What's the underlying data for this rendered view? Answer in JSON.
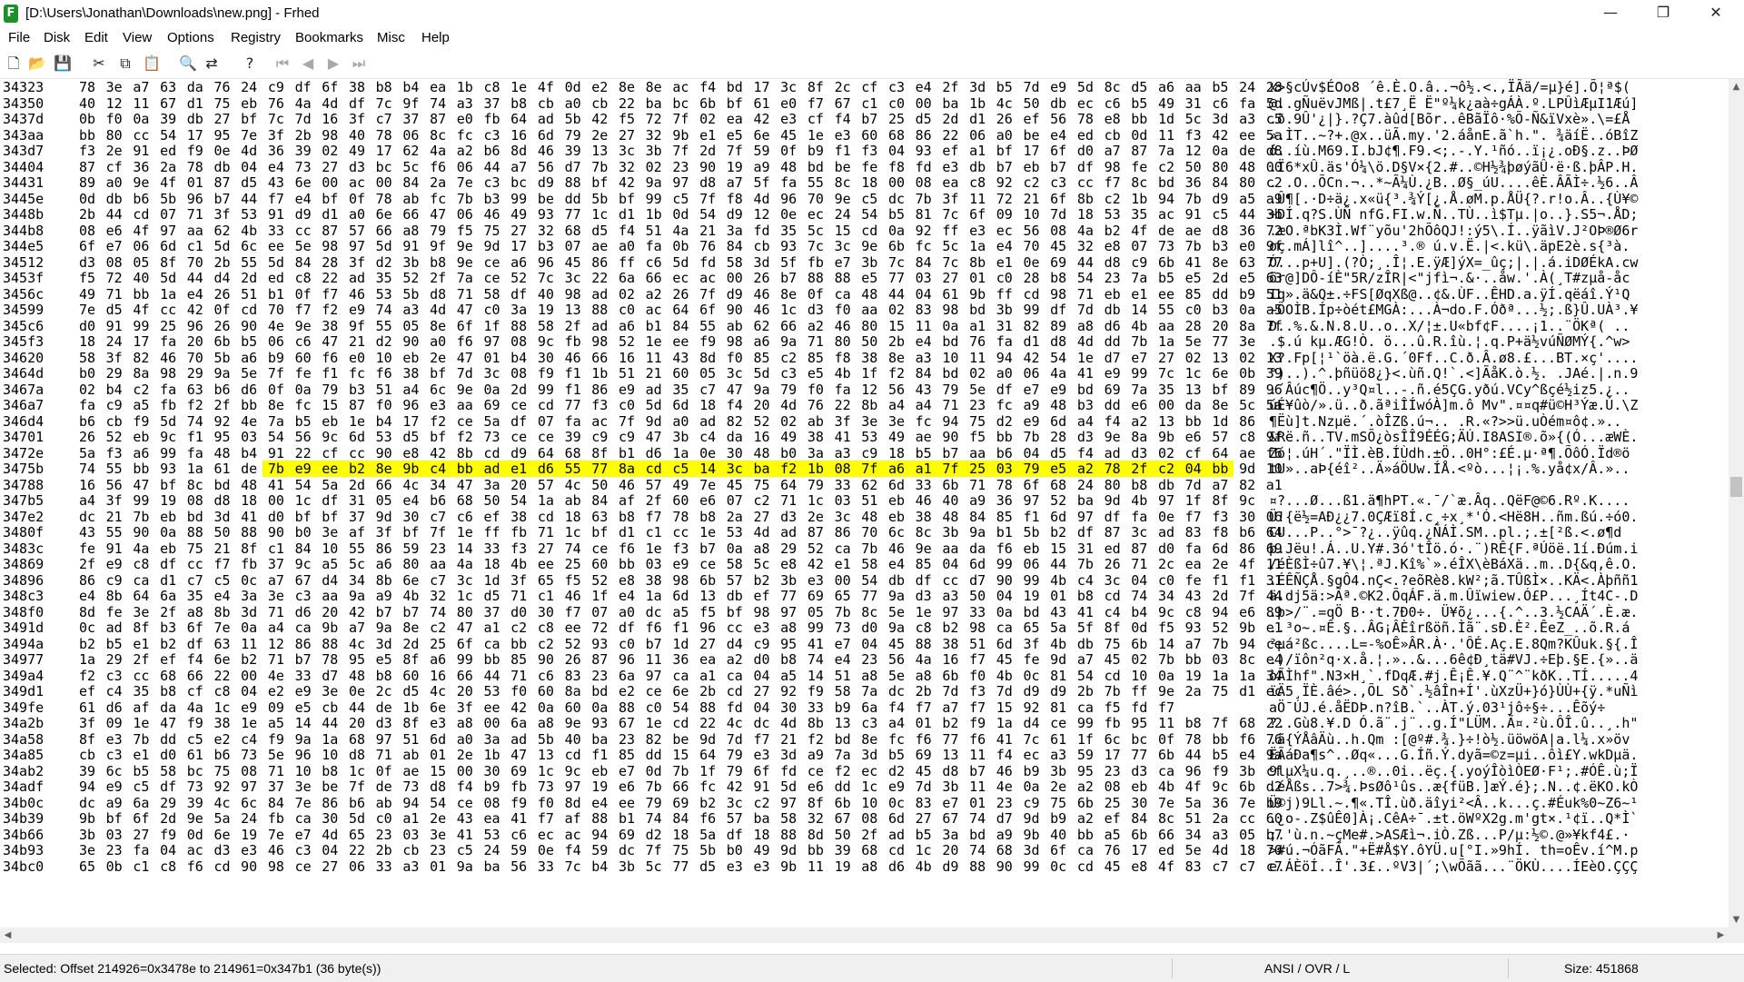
{
  "window": {
    "title": "[D:\\Users\\Jonathan\\Downloads\\new.png] - Frhed",
    "app_icon_letter": "F",
    "minimize": "—",
    "maximize": "❐",
    "close": "✕"
  },
  "menu": [
    "File",
    "Disk",
    "Edit",
    "View",
    "Options",
    "Registry",
    "Bookmarks",
    "Misc",
    "Help"
  ],
  "toolbar": {
    "buttons": [
      {
        "name": "new-file-icon",
        "glyph": "🗋",
        "disabled": false
      },
      {
        "name": "open-folder-icon",
        "glyph": "📂",
        "disabled": false
      },
      {
        "name": "save-icon",
        "glyph": "💾",
        "disabled": false
      },
      {
        "name": "cut-icon",
        "glyph": "✂",
        "disabled": false
      },
      {
        "name": "copy-icon",
        "glyph": "⧉",
        "disabled": false
      },
      {
        "name": "paste-icon",
        "glyph": "📋",
        "disabled": false
      },
      {
        "name": "find-icon",
        "glyph": "🔍",
        "disabled": false
      },
      {
        "name": "replace-icon",
        "glyph": "⇄",
        "disabled": false
      },
      {
        "name": "help-icon",
        "glyph": "?",
        "disabled": false
      },
      {
        "name": "first-icon",
        "glyph": "⏮",
        "disabled": true
      },
      {
        "name": "prev-icon",
        "glyph": "◀",
        "disabled": true
      },
      {
        "name": "next-icon",
        "glyph": "▶",
        "disabled": true
      },
      {
        "name": "last-icon",
        "glyph": "⏭",
        "disabled": true
      }
    ]
  },
  "hex_view": {
    "selected_row": 24,
    "selected_start_col": 7,
    "selected_end_col": 42,
    "rows": [
      {
        "offset": "34323",
        "bytes": "78 3e a7 63 da 76 24 c9 df 6f 38 b8 b4 ea 1b c8 1e 4f 0d e2 8e 8e ac f4 bd 17 3c 8f 2c cf c3 e4 2f 3d b5 7d e9 5d 8c d5 a6 aa b5 24 28",
        "ascii": "x>§cÚv$É߀o8 ´ê.È.O.â..¬ô½.<.,ÏÃä/=µ}é].Õ¦ª$("
      },
      {
        "offset": "34350",
        "bytes": "40 12 11 67 d1 75 eb 76 4a 4d df 7c 9f 74 a3 37 b8 cb a0 cb 22 ba bc 6b bf 61 e0 f7 67 c1 c0 00 ba 1b 4c 50 db ec c6 b5 49 31 c6 fa 5d",
        "ascii": "@..gÑuëvJMß|.t£7¸Ë Ë\"º¼k¿aà÷gÁÀ.º.LPÛìÆµI1Æú]"
      },
      {
        "offset": "3437d",
        "bytes": "0b f0 0a 39 db 27 bf 7c 7d 16 3f c7 37 87 e0 fb 64 ad 5b 42 f5 72 7f 02 ea 42 e3 cf f4 b7 25 d5 2d d1 26 ef 56 78 e8 bb 1d 5c 3d a3 c5",
        "ascii": ".ð.9Û'¿|}.?Ç7.àûd­[Bõr..êBãÏô·%Õ-Ñ&ïVxè».\\=£Å"
      },
      {
        "offset": "343aa",
        "bytes": "bb 80 cc 54 17 95 7e 3f 2b 98 40 78 06 8c fc c3 16 6d 79 2e 27 32 9b e1 e5 6e 45 1e e3 60 68 86 22 06 a0 be e4 ed cb 0d 11 f3 42 ee 5a",
        "ascii": "».ÌT..~?+.@x..üÃ.my.'2.áånE.ã`h.\". ¾äíË..óBîZ"
      },
      {
        "offset": "343d7",
        "bytes": "f3 2e 91 ed f9 0e 4d 36 39 02 49 17 62 4a a2 b6 8d 46 39 13 3c 3b 7f 2d 7f 59 0f b9 f1 f3 04 93 ef a1 bf 17 6f d0 a7 87 7a 12 0a de d8",
        "ascii": "ó..íù.M69.I.bJ¢¶.F9.<;.-.Y.¹ñó..ï¡¿.oÐ§.z..ÞØ"
      },
      {
        "offset": "34404",
        "bytes": "87 cf 36 2a 78 db 04 e4 73 27 d3 bc 5c f6 06 44 a7 56 d7 7b 32 02 23 90 19 a9 48 bd be fe f8 fd e3 db b7 eb b7 df 98 fe c2 50 80 48 00",
        "ascii": ".Ï6*xÛ.äs'Ó¼\\ö.D§V×{2.#..©H½¾þøýãÛ·ë·ß.þÂP.H."
      },
      {
        "offset": "34431",
        "bytes": "89 a0 9e 4f 01 87 d5 43 6e 00 ac 00 84 2a 7e c3 bc d9 88 bf 42 9a 97 d8 a7 5f fa 55 8c 18 00 08 ea c8 92 c2 c3 cc f7 8c bd 36 84 80 c2",
        "ascii": ". .O..ÕCn.¬..*~Ã¼Ù.¿B..Ø§_úU....êÈ.ÂÃÌ÷.½6..Â"
      },
      {
        "offset": "3445e",
        "bytes": "0d db b6 5b 96 b7 44 f7 e4 bf 0f 78 ab fc 7b b3 99 be dd 5b bf 99 c5 7f f8 4d 96 70 9e c5 dc 7b 3f 11 72 21 6f 8b c2 1b 94 7b d9 a5 a9",
        "ascii": ".Û¶[.·D÷ä¿.x«ü{³.¾Ý[¿.Å.øM.p.ÅÜ{?.r!o.Â..{Ù¥©"
      },
      {
        "offset": "3448b",
        "bytes": "2b 44 cd 07 71 3f 53 91 d9 d1 a0 6e 66 47 06 46 49 93 77 1c d1 1b 0d 54 d9 12 0e ec 24 54 b5 81 7c 6f 09 10 7d 18 53 35 ac 91 c5 44 3b",
        "ascii": "+DÍ.q?S.ÙÑ nfG.FI.w.Ñ..TÙ..ì$Tµ.|o..}.S5¬.ÅD;"
      },
      {
        "offset": "344b8",
        "bytes": "08 e6 4f 97 aa 62 4b 33 cc 87 57 66 a8 79 f5 75 27 32 68 d5 f4 51 4a 21 3a fd 35 5c 15 cd 0a 92 ff e3 ec 56 08 4a b2 4f de ae d8 36 72",
        "ascii": ".æO.ªbK3Ì.Wf¨yõu'2hÕôQJ!:ý5\\.Í..ÿãìV.J²OÞ®Ø6r"
      },
      {
        "offset": "344e5",
        "bytes": "6f e7 06 6d c1 5d 6c ee 5e 98 97 5d 91 9f 9e 9d 17 b3 07 ae a0 fa 0b 76 84 cb 93 7c 3c 9e 6b fc 5c 1a e4 70 45 32 e8 07 73 7b b3 e0 9f",
        "ascii": "oç.mÁ]lî^..]....³.® ú.v.Ë.|<.kü\\.äpE2è.s{³à."
      },
      {
        "offset": "34512",
        "bytes": "d3 08 05 8f 70 2b 55 5d 84 28 3f d2 3b b8 9e ce a6 96 45 86 ff c6 5d fd 58 3d 5f fb e7 3b 7c 84 7c 8b e1 0e 69 44 d8 c9 6b 41 8e 63 77",
        "ascii": "Ó...p+U].(?Ò;¸.Î¦.E.ÿÆ]ýX=_ûç;|.|.á.iDØÉkA.cw"
      },
      {
        "offset": "3453f",
        "bytes": "f5 72 40 5d 44 d4 2d ed c8 22 ad 35 52 2f 7a ce 52 7c 3c 22 6a 66 ec ac 00 26 b7 88 88 e5 77 03 27 01 c0 28 b8 54 23 7a b5 e5 2d e5 63",
        "ascii": "õr@]DÔ-íÈ\"­5R/zÎR|<\"jfì¬.&·..åw.'.À(¸T#zµå-åc"
      },
      {
        "offset": "3456c",
        "bytes": "49 71 bb 1a e4 26 51 b1 0f f7 46 53 5b d8 71 58 df 40 98 ad 02 a2 26 7f d9 46 8e 0f ca 48 44 04 61 9b ff cd 98 71 eb e1 ee 85 dd b9 51",
        "ascii": "Iq».ä&Q±.÷FS[ØqXß@.­.¢&.ÙF..ÊHD.a.ÿÍ.qëáî.Ý¹Q"
      },
      {
        "offset": "34599",
        "bytes": "7e d5 4f cc 42 0f cd 70 f7 f2 e9 74 a3 4d 47 c0 3a 19 13 88 c0 ac 64 6f 90 46 1c d3 f0 aa 02 83 98 bd 3b 99 df 7d db 14 55 c0 b3 0a a5",
        "ascii": "~ÕOÌB.Íp÷òét£MGÀ:...À¬do.F.Óðª...½;.ß}Û.UÀ³.¥"
      },
      {
        "offset": "345c6",
        "bytes": "d0 91 99 25 96 26 90 4e 9e 38 9f 55 05 8e 6f 1f 88 58 2f ad a6 b1 84 55 ab 62 66 a2 46 80 15 11 0a a1 31 82 89 a8 d6 4b aa 28 20 8a 7f",
        "ascii": "Ð..%.&.N.8.U..o..X/­¦±.U«bf¢F....¡1..¨ÖKª( .."
      },
      {
        "offset": "345f3",
        "bytes": "18 24 17 fa 20 6b b5 06 c6 47 21 d2 90 a0 f6 97 08 9c fb 98 52 1e ee f9 98 a6 9a 71 80 50 2b e4 bd 76 fa d1 d8 4d dd 7b 1a 5e 77 3e",
        "ascii": ".$.ú kµ.ÆG!Ò. ö...û.R.îù.¦.q.P+ä½vúÑØMÝ{.^w>"
      },
      {
        "offset": "34620",
        "bytes": "58 3f 82 46 70 5b a6 b9 60 f6 e0 10 eb 2e 47 01 b4 30 46 66 16 11 43 8d f0 85 c2 85 f8 38 8e a3 10 11 94 42 54 1e d7 e7 27 02 13 02 13",
        "ascii": "X?.Fp[¦¹`öà.ë.G.´0Ff..C.ð.Â.ø8.£...BT.×ç'...."
      },
      {
        "offset": "3464d",
        "bytes": "b0 29 8a 98 29 9a 5e 7f fe f1 fc f6 38 bf 7d 3c 08 f9 f1 1b 51 21 60 05 3c 5d c3 e5 4b 1f f2 84 bd 02 a0 06 4a 41 e9 99 7c 1c 6e 0b 39",
        "ascii": "°)..).^.þñüö8¿}<.ùñ.Q!`.<]ÃåK.ò.½. .JAé.|.n.9"
      },
      {
        "offset": "3467a",
        "bytes": "02 b4 c2 fa 63 b6 d6 0f 0a 79 b3 51 a4 6c 9e 0a 2d 99 f1 86 e9 ad 35 c7 47 9a 79 f0 fa 12 56 43 79 5e df e7 e9 bd 69 7a 35 13 bf 89 96",
        "ascii": ".´Âúc¶Ö..y³Q¤l..-.ñ.é­5ÇG.yðú.VCy^ßçé½iz5.¿.."
      },
      {
        "offset": "346a7",
        "bytes": "fa c9 a5 fb f2 2f bb 8e fc 15 87 f0 96 e3 aa 69 ce cd 77 f3 c0 5d 6d 18 f4 20 4d 76 22 8b a4 a4 71 23 fc a9 48 b3 dd e6 00 da 8e 5c 5a",
        "ascii": "úÉ¥ûò/».ü..ð.ãªiÎÍwóÀ]m.ô Mv\".¤¤q#ü©H³Ýæ.Ú.\\Z"
      },
      {
        "offset": "346d4",
        "bytes": "b6 cb f9 5d 74 92 4e 7a b5 eb 1e b4 17 f2 ce 5a df 07 fa ac 7f 9d a0 ad 82 52 02 ab 3f 3e 3e fc 94 75 d2 e9 6d a4 f4 a2 13 bb 1d 86",
        "ascii": "¶Ëù]t.Nzµë.´.òÎZß.ú¬.. ­.R.«?>>ü.uÒém¤ô¢.».."
      },
      {
        "offset": "34701",
        "bytes": "26 52 eb 9c f1 95 03 54 56 9c 6d 53 d5 bf f2 73 ce ce 39 c9 c9 47 3b c4 da 16 49 38 41 53 49 ae 90 f5 bb 7b 28 d3 9e 8a 9b e6 57 c8 9f",
        "ascii": "&Rë.ñ..TV.mSÕ¿òsÎÎ9ÉÉG;ÄÚ.I8ASI®.õ»{(Ó...æWÈ."
      },
      {
        "offset": "3472e",
        "bytes": "5a f3 a6 99 fa 48 b4 91 22 cf cc 90 e8 42 8b cd d9 64 68 8f b1 d6 1a 0e 30 48 b0 3a a3 c9 18 b5 b7 aa b6 04 d5 f4 ad d3 02 cf 64 ae f6",
        "ascii": "Zó¦.úH´.\"ÏÌ.èB.ÍÙdh.±Ö..0H°:£É.µ·ª¶.Õô­Ó.Ïd®ö"
      },
      {
        "offset": "3475b",
        "bytes": "74 55 bb 93 1a 61 de 7b e9 ee b2 8e 9b c4 bb ad e1 d6 55 77 8a cd c5 14 3c ba f2 1b 08 7f a6 a1 7f 25 03 79 e5 a2 78 2f c2 04 bb 9d 10",
        "ascii": "tU»..aÞ{éî²..Ä»­áÖUw.ÍÅ.<ºò...¦¡.%.yå¢x/Â.».."
      },
      {
        "offset": "34788",
        "bytes": "16 56 47 bf 8c bd 48 41 54 5a 2d 66 4c 34 47 3a 20 57 4c 50 46 57 49 7e 45 75 64 79 33 62 6d 33 6b 71 78 6f 68 24 80 b8 db 7d a7 82 a1",
        "ascii_pre": ".VG¿.½",
        "ascii_sel": "HATZ-fL4G: WLPFWI~Eudy3bm3kqxoh$.¸Û}",
        "ascii_post": "§.¡"
      },
      {
        "offset": "347b5",
        "bytes": "a4 3f 99 19 08 d8 18 00 1c df 31 05 e4 b6 68 50 54 1a ab 84 af 2f 60 e6 07 c2 71 1c 03 51 eb 46 40 a9 36 97 52 ba 9d 4b 97 1f 8f 9c",
        "ascii": "¤?...Ø...ß1.ä¶hPT.«.¯/`æ.Âq..QëF@©6.Rº.K...."
      },
      {
        "offset": "347e2",
        "bytes": "dc 21 7b eb bd 3d 41 d0 bf bf 37 9d 30 c7 c6 ef 38 cd 18 63 b8 f7 78 b8 2a 27 d3 2e 3c 48 eb 38 48 84 85 f1 6d 97 df fa 0e f7 f3 30 06",
        "ascii": "Ü!{ë½=AÐ¿¿7.0ÇÆï8Í.c¸÷x¸*'Ó.<Hë8H..ñm.ßú.÷ó0."
      },
      {
        "offset": "3480f",
        "bytes": "43 55 90 0a 88 50 88 90 b0 3e af 3f bf 7f 1e ff fb 71 1c bf d1 c1 cc 1e 53 4d ad 87 86 70 6c 8c 3b 9a b1 5b b2 df 87 3c ad 83 f8 b6 64",
        "ascii": "CU...P..°>¯?¿..ÿûq.¿ÑÁÌ.SM­..pl.;.±[²ß.<­.ø¶d"
      },
      {
        "offset": "3483c",
        "bytes": "fe 91 4a eb 75 21 8f c1 84 10 55 86 59 23 14 33 f3 27 74 ce f6 1e f3 b7 0a a8 29 52 ca 7b 46 9e aa da f6 eb 15 31 ed 87 d0 fa 6d 86 69",
        "ascii": "þ.Jëu!.Á..U.Y#.3ó'tÎö.ó·.¨)RÊ{F.ªÚöë.1í.Ðúm.i"
      },
      {
        "offset": "34869",
        "bytes": "2f e9 c8 df cc f7 fb 37 9c a5 5c a6 80 aa 4a 18 4b ee 25 60 bb 03 e9 ce 58 5c e8 42 e1 58 e4 85 04 6d 99 06 44 7b 26 71 2c ea 2e 4f 11",
        "ascii": "/éÈßÌ÷û7.¥\\¦.ªJ.Kî%`».éÎX\\èBáXä..m..D{&q,ê.O."
      },
      {
        "offset": "34896",
        "bytes": "86 c9 ca d1 c7 c5 0c a7 67 d4 34 8b 6e c7 3c 1d 3f 65 f5 52 e8 38 98 6b 57 b2 3b e3 00 54 db df cc d7 90 99 4b c4 3c 04 c0 fe f1 f1 31",
        "ascii": ".ÉÊÑÇÅ.§gÔ4.nÇ<.?eõRè8.kW²;ã.TÛßÌ×..KÄ<.Àþññ1"
      },
      {
        "offset": "348c3",
        "bytes": "e4 8b 64 6a 35 e4 3a 3e c3 aa 9a a9 4b 32 1c d5 71 c1 46 1f e4 1a 6d 13 db ef 77 69 65 77 9a d3 a3 50 04 19 01 b8 cd 74 34 43 2d 7f 44",
        "ascii": "ä.dj5ä:>Ãª.©K2.ÕqÁF.ä.m.Ûïwiew.Ó£P...¸Ít4C-.D"
      },
      {
        "offset": "348f0",
        "bytes": "8d fe 3e 2f a8 8b 3d 71 d6 20 42 b7 b7 74 80 37 d0 30 f7 07 a0 dc a5 f5 bf 98 97 05 7b 8c 5e 1e 97 33 0a bd 43 41 c4 b4 9c c8 94 e6 89",
        "ascii": ".þ>/¨.=qÖ B··t.7Ð0÷. Ü¥õ¿...{.^..3.½CAÄ´.È.æ."
      },
      {
        "offset": "3491d",
        "bytes": "0c ad 8f b3 6f 7e 0a a4 ca 9b a7 9a 8e c2 47 a1 c2 c8 ee 72 df f6 f1 96 cc e3 a8 99 73 d0 9a c8 b2 98 ca 65 5a 5f 8f 0d f5 93 52 9b e1",
        "ascii": ".­.³o~.¤Ê.§..ÂG¡ÂÈîrßöñ.Ìã¨.sÐ.È².ÊeZ_..õ.R.á"
      },
      {
        "offset": "3494a",
        "bytes": "b2 b5 e1 b2 df 63 11 12 86 88 4c 3d 2d 25 6f ca bb c2 52 93 c0 b7 1d 27 d4 c9 95 41 e7 04 45 88 38 51 6d 3f 4b db 75 6b 14 a7 7b 94 ce",
        "ascii": "²µá²ßc....L=-%oÊ»ÂR.À·.'ÔÉ.Aç.E.8Qm?KÛuk.§{.Î"
      },
      {
        "offset": "34977",
        "bytes": "1a 29 2f ef f4 6e b2 71 b7 78 95 e5 8f a6 99 bb 85 90 26 87 96 11 36 ea a2 d0 b8 74 e4 23 56 4a 16 f7 45 fe 9d a7 45 02 7b bb 03 8c e4",
        "ascii": ".)/ïôn²q·x.å.¦.»..&...6ê¢Ð¸tä#VJ.÷Eþ.§E.{»..ä"
      },
      {
        "offset": "349a4",
        "bytes": "f2 c3 cc 68 66 22 00 4e 33 d7 48 b8 60 16 66 44 71 c6 83 23 6a 97 ca a1 ca 04 a5 14 51 a8 5e a8 6b f0 4b 0c 81 54 cd 10 0a 19 1a 1a 34",
        "ascii": "òÃÌhf\".N3×H¸`.fDqÆ.#j.Ê¡Ê.¥.Q¨^¨kðK..TÍ.....4"
      },
      {
        "offset": "349d1",
        "bytes": "ef c4 35 b8 cf c8 04 e2 e9 3e 0e 2c d5 4c 20 53 f0 60 8a bd e2 ce 6e 2b cd 27 92 f9 58 7a dc 2b 7d f3 7d d9 d9 2b 7b ff 9e 2a 75 d1 ec",
        "ascii": "ïÄ5¸ÏÈ.âé>.,ÕL Sð`.½âÎn+Í'.ùXzÜ+}ó}ÙÙ+{ÿ.*uÑì"
      },
      {
        "offset": "349fe",
        "bytes": "61 d6 af da 4a 1c e9 09 e5 cb 44 de 1b 6e 3f ee 42 0a 60 0a 88 c0 54 88 fd 04 30 33 b9 6a f4 f7 a7 f7 15 92 81 ca f5 fd f7",
        "ascii": "aÖ¯ÚJ.é.åËDÞ.n?îB.`..ÀT.ý.03¹jô÷§÷...Êõý÷"
      },
      {
        "offset": "34a2b",
        "bytes": "3f 09 1e 47 f9 38 1e a5 14 44 20 d3 8f e3 a8 00 6a a8 9e 93 67 1e cd 22 4c dc 4d 8b 13 c3 a4 01 b2 f9 1a d4 ce 99 fb 95 11 b8 7f 68 22",
        "ascii": "?..Gù8.¥.D Ó.ã¨.j¨..g.Í\"LÜM..Ã¤.²ù.ÔÎ.û..¸.h\""
      },
      {
        "offset": "34a58",
        "bytes": "8f e3 7b dd c5 e2 c4 f9 9a 1a 68 97 51 6d a0 3a ad 5b 40 ba 23 82 be 9d 7d f7 21 f2 bd 8e fc f6 77 f6 41 7c 61 1f 6c bc 0f 78 bb f6 76",
        "ascii": ".ã{ÝÅâÄù..h.Qm :­[@º#.¾.}÷!ò½.üöwöA|a.l¼.x»öv"
      },
      {
        "offset": "34a85",
        "bytes": "cb c3 e1 d0 61 b6 73 5e 96 10 d8 71 ab 01 2e 1b 47 13 cd f1 85 dd 15 64 79 e3 3d a9 7a 3d b5 69 13 11 f4 ec a3 59 17 77 6b 44 b5 e4 9a",
        "ascii": "ËÃáÐa¶s^..Øq«...G.Íñ.Ý.dyã=©z=µi..ôì£Y.wkDµä."
      },
      {
        "offset": "34ab2",
        "bytes": "39 6c b5 58 bc 75 08 71 10 b8 1c 0f ae 15 00 30 69 1c 9c eb e7 0d 7b 1f 79 6f fd ce f2 ec d2 45 d8 b7 46 b9 3b 95 23 d3 ca 96 f9 3b cf",
        "ascii": "9lµX¼u.q.¸..®..0i..ëç.{.yoýÎòìÒEØ·F¹;.#ÓÊ.ù;Ï"
      },
      {
        "offset": "34adf",
        "bytes": "94 e9 c5 df 73 92 97 37 3e be 7f de 73 d8 f4 b9 fb 73 97 19 e6 7b 66 fc 42 91 5d e6 dd 1c e9 7d 3b 11 4e 0a 2e a2 08 eb 4b 4f 9c 6b d2",
        "ascii": ".éÅßs..7>¾.ÞsØô¹ûs..æ{füB.]æÝ.é};.N..¢.ëKO.kÒ"
      },
      {
        "offset": "34b0c",
        "bytes": "dc a9 6a 29 39 4c 6c 84 7e 86 b6 ab 94 54 ce 08 f9 f0 8d e4 ee 79 69 b2 3c c2 97 8f 6b 10 0c 83 e7 01 23 c9 75 6b 25 30 7e 5a 36 7e b9",
        "ascii": "Ü©j)9Ll.~.¶«.TÎ.ùð.äîyi²<Â..k...ç.#Éuk%0~Z6~¹"
      },
      {
        "offset": "34b39",
        "bytes": "9b bf 6f 2d 9e 5a 24 fb ca 30 5d c0 a1 2e 43 ea 41 f7 af 88 b1 74 84 f6 57 ba 58 32 67 08 6d 27 67 74 d7 9d b9 a2 ef 84 8c 51 2a cc 60",
        "ascii": ".¿o-.Z$ûÊ0]À¡.CêA÷¯.±t.öWºX2g.m'gt×.¹¢ï..Q*Ì`"
      },
      {
        "offset": "34b66",
        "bytes": "3b 03 27 f9 0d 6e 19 7e e7 4d 65 23 03 3e 41 53 c6 ec ac 94 69 d2 18 5a df 18 88 8d 50 2f ad b5 3a bd a9 9b 40 bb a5 6b 66 34 a3 05 b7",
        "ascii": ";.'ù.n.~çMe#.>ASÆì¬.iÒ.Zß...P/­µ:½©.@»¥kf4£.·"
      },
      {
        "offset": "34b93",
        "bytes": "3e 23 fa 04 ac d3 e3 46 c3 04 22 2b cb 23 c5 24 59 0e f4 59 dc 7f 75 5b b0 49 9d bb 39 68 cd 1c 20 74 68 3d 6f ca 76 17 ed 5e 4d 18 70",
        "ascii": ">#ú.¬ÓãFÃ.\"+Ë#Å$Y.ôYÜ.u[°I.»9hÍ. th=oÊv.í^M.p"
      },
      {
        "offset": "34bc0",
        "bytes": "65 0b c1 c8 f6 cd 90 98 ce 27 06 33 a3 01 9a ba 56 33 7c b4 3b 5c 77 d5 e3 e3 9b 11 19 a8 d6 4b d9 88 90 99 0c cd 45 e8 4f 83 c7 c7 c7",
        "ascii": "e.ÁÈöÍ..Î'.3£..ºV3|´;\\wÕãã...¨ÖKÙ....ÍEèO.ÇÇÇ"
      }
    ]
  },
  "status": {
    "selection": "Selected: Offset 214926=0x3478e to 214961=0x347b1 (36 byte(s))",
    "mode": "ANSI / OVR / L",
    "size": "Size: 451868"
  },
  "scroll": {
    "up": "▲",
    "down": "▼",
    "left": "◀",
    "right": "▶"
  }
}
